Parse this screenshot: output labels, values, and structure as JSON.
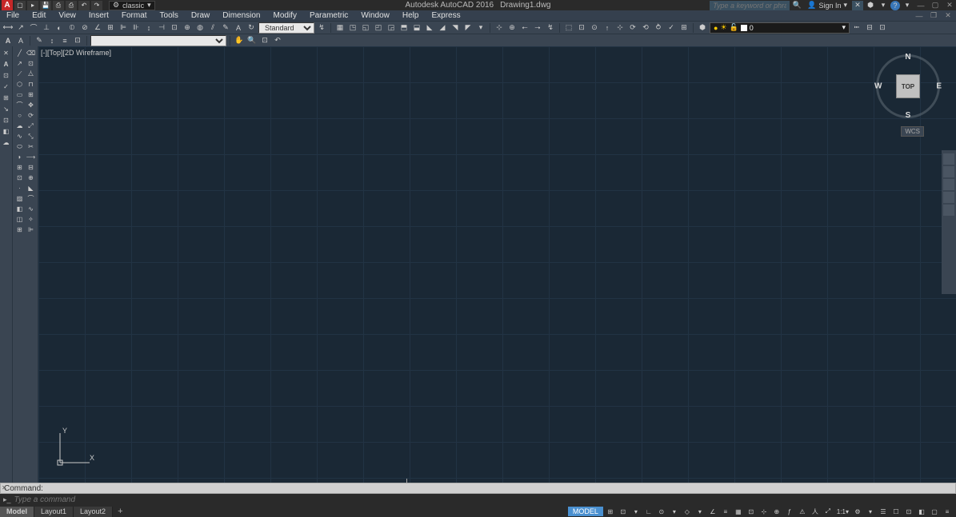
{
  "titlebar": {
    "app_name": "Autodesk AutoCAD 2016",
    "file_name": "Drawing1.dwg",
    "workspace_label": "classic",
    "search_placeholder": "Type a keyword or phrase",
    "sign_in_label": "Sign In"
  },
  "menu": {
    "items": [
      "File",
      "Edit",
      "View",
      "Insert",
      "Format",
      "Tools",
      "Draw",
      "Dimension",
      "Modify",
      "Parametric",
      "Window",
      "Help",
      "Express"
    ]
  },
  "toolbar1": {
    "style_dropdown": "Standard",
    "layer_name": "0"
  },
  "viewport": {
    "label_parts": [
      "[-]",
      "[Top]",
      "[2D Wireframe]"
    ]
  },
  "viewcube": {
    "face": "TOP",
    "dirs": [
      "N",
      "E",
      "S",
      "W"
    ],
    "wcs": "WCS"
  },
  "ucs": {
    "x": "X",
    "y": "Y"
  },
  "command": {
    "prompt_label": "Command:",
    "input_placeholder": "Type a command"
  },
  "layout": {
    "tabs": [
      "Model",
      "Layout1",
      "Layout2"
    ]
  },
  "status": {
    "model": "MODEL",
    "scale": "1:1"
  }
}
